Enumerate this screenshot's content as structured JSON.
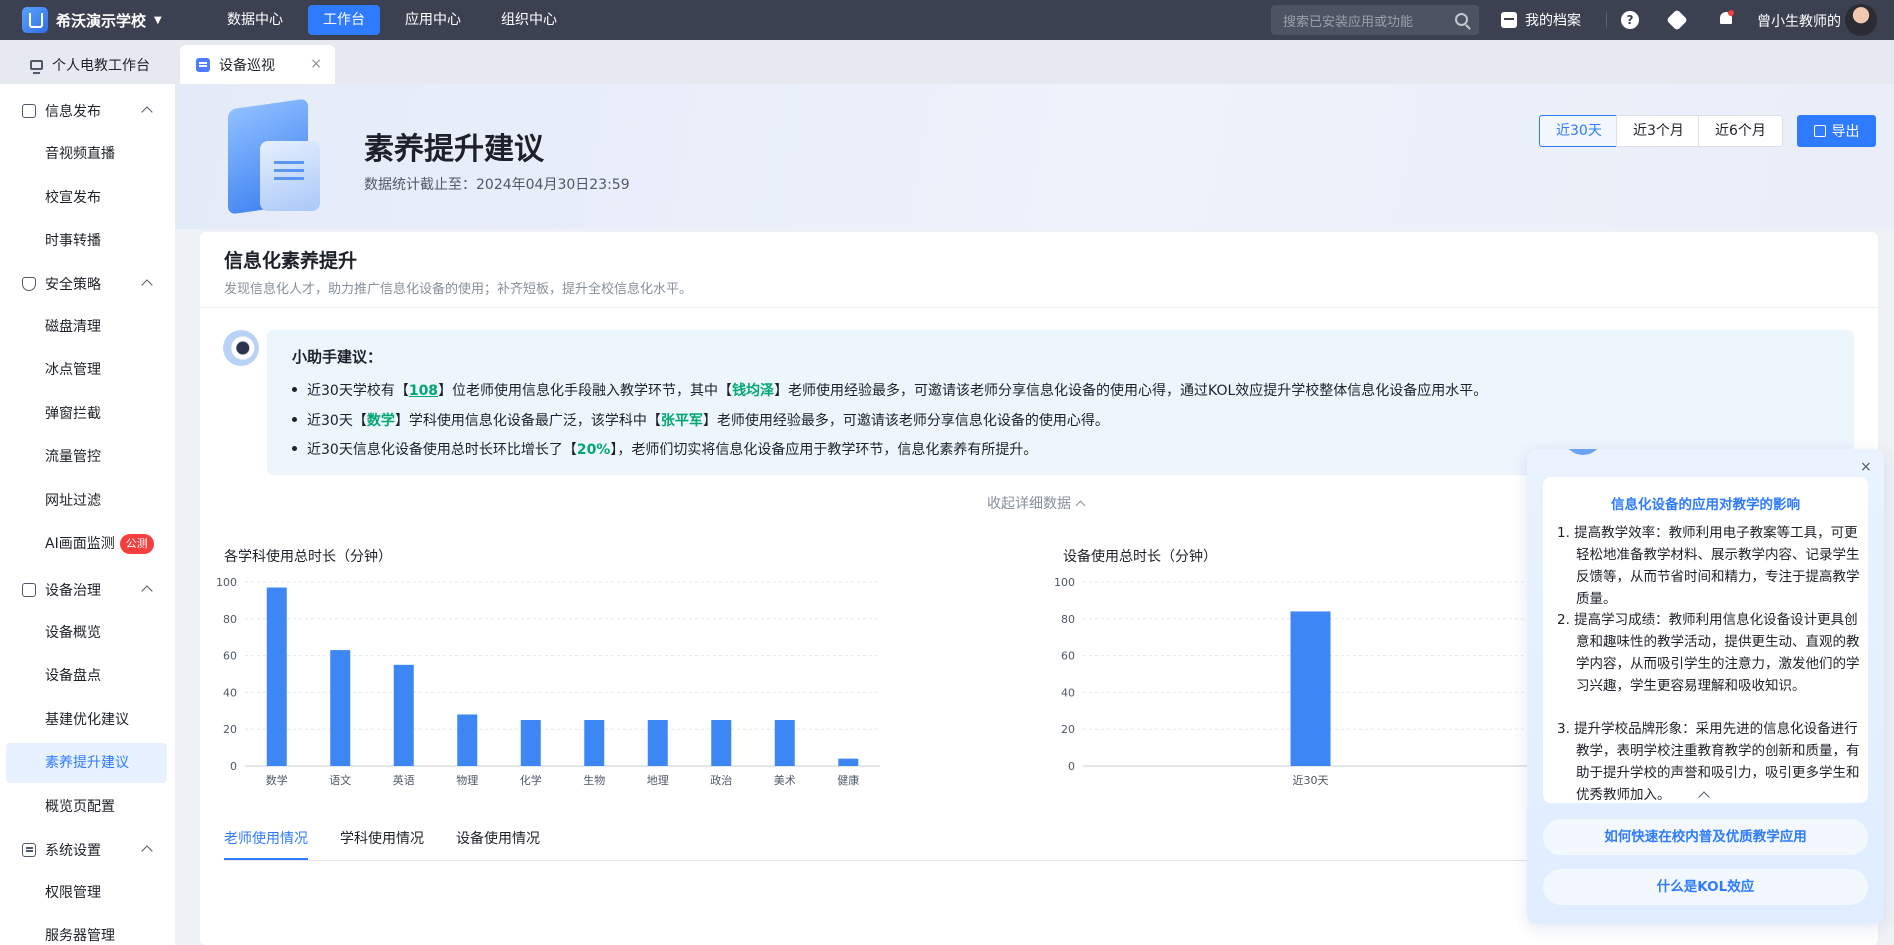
{
  "topbar": {
    "school": "希沃演示学校",
    "nav": [
      "数据中心",
      "工作台",
      "应用中心",
      "组织中心"
    ],
    "active_nav": 1,
    "search_placeholder": "搜索已安装应用或功能",
    "archive": "我的档案",
    "help_icon": "?",
    "user": "曾小生教师的"
  },
  "tabs": {
    "home": "个人电教工作台",
    "current": "设备巡视",
    "close": "×"
  },
  "sidebar": {
    "groups": [
      {
        "label": "信息发布",
        "icon": "broadcast-icon",
        "items": [
          "音视频直播",
          "校宣发布",
          "时事转播"
        ]
      },
      {
        "label": "安全策略",
        "icon": "shield-icon",
        "items": [
          "磁盘清理",
          "冰点管理",
          "弹窗拦截",
          "流量管控",
          "网址过滤",
          "AI画面监测"
        ]
      },
      {
        "label": "设备治理",
        "icon": "device-icon",
        "items": [
          "设备概览",
          "设备盘点",
          "基建优化建议",
          "素养提升建议",
          "概览页配置"
        ]
      },
      {
        "label": "系统设置",
        "icon": "settings-list-icon",
        "items": [
          "权限管理",
          "服务器管理"
        ]
      }
    ],
    "badge": "公测",
    "active_item": "素养提升建议"
  },
  "hero": {
    "title": "素养提升建议",
    "subtitle": "数据统计截止至：2024年04月30日23:59",
    "ranges": [
      "近30天",
      "近3个月",
      "近6个月"
    ],
    "active_range": 0,
    "export": "导出"
  },
  "card": {
    "title": "信息化素养提升",
    "subtitle": "发现信息化人才，助力推广信息化设备的使用；补齐短板，提升全校信息化水平。",
    "advice_title": "小助手建议：",
    "advice": [
      [
        "近30天学校有【",
        "108",
        "】位老师使用信息化手段融入教学环节，其中【",
        "钱均泽",
        "】老师使用经验最多，可邀请该老师分享信息化设备的使用心得，通过KOL效应提升学校整体信息化设备应用水平。"
      ],
      [
        "近30天【",
        "数学",
        "】学科使用信息化设备最广泛，该学科中【",
        "张平军",
        "】老师使用经验最多，可邀请该老师分享信息化设备的使用心得。"
      ],
      [
        "近30天信息化设备使用总时长环比增长了【",
        "20%",
        "】，老师们切实将信息化设备应用于教学环节，信息化素养有所提升。"
      ]
    ],
    "collapse": "收起详细数据",
    "bottom_tabs": [
      "老师使用情况",
      "学科使用情况",
      "设备使用情况"
    ],
    "active_bottom_tab": 0
  },
  "chart_data": [
    {
      "type": "bar",
      "title": "各学科使用总时长（分钟）",
      "categories": [
        "数学",
        "语文",
        "英语",
        "物理",
        "化学",
        "生物",
        "地理",
        "政治",
        "美术",
        "健康"
      ],
      "values": [
        97,
        63,
        55,
        28,
        25,
        25,
        25,
        25,
        25,
        4
      ],
      "ylim": [
        0,
        100
      ],
      "yticks": [
        0,
        20,
        40,
        60,
        80,
        100
      ],
      "grid": true,
      "color": "#3d87f5"
    },
    {
      "type": "bar",
      "title": "设备使用总时长（分钟）",
      "categories": [
        "近30天"
      ],
      "values": [
        84
      ],
      "ylim": [
        0,
        100
      ],
      "yticks": [
        0,
        20,
        40,
        60,
        80,
        100
      ],
      "grid": true,
      "color": "#3d87f5"
    }
  ],
  "panel": {
    "close": "×",
    "heading": "信息化设备的应用对教学的影响",
    "items": [
      "1. 提高教学效率：教师利用电子教案等工具，可更轻松地准备教学材料、展示教学内容、记录学生反馈等，从而节省时间和精力，专注于提高教学质量。",
      "2. 提高学习成绩：教师利用信息化设备设计更具创意和趣味性的教学活动，提供更生动、直观的教学内容，从而吸引学生的注意力，激发他们的学习兴趣，学生更容易理解和吸收知识。",
      "3. 提升学校品牌形象：采用先进的信息化设备进行教学，表明学校注重教育教学的创新和质量，有助于提升学校的声誉和吸引力，吸引更多学生和优秀教师加入。"
    ],
    "links": [
      "如何快速在校内普及优质教学应用",
      "什么是KOL效应"
    ]
  },
  "colors": {
    "accent": "#2f7bff",
    "highlight": "#00a870",
    "topbar": "#3b4150"
  }
}
